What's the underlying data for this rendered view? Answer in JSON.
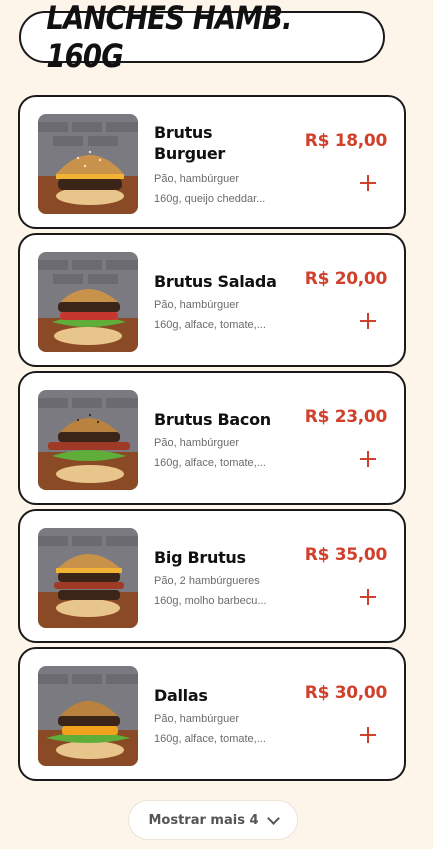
{
  "section_title": "LANCHES HAMB. 160G",
  "items": [
    {
      "name": "Brutus Burguer",
      "name_line1": "Brutus",
      "name_line2": "Burguer",
      "desc_line1": "Pão, hambúrguer",
      "desc_line2": "160g, queijo cheddar...",
      "price": "R$ 18,00",
      "image": "burger-cheese-photo"
    },
    {
      "name": "Brutus Salada",
      "desc_line1": "Pão, hambúrguer",
      "desc_line2": "160g, alface, tomate,...",
      "price": "R$ 20,00",
      "image": "burger-salad-photo"
    },
    {
      "name": "Brutus Bacon",
      "desc_line1": "Pão, hambúrguer",
      "desc_line2": "160g, alface, tomate,...",
      "price": "R$ 23,00",
      "image": "burger-bacon-photo"
    },
    {
      "name": "Big Brutus",
      "desc_line1": "Pão, 2 hambúrgueres",
      "desc_line2": "160g, molho barbecu...",
      "price": "R$ 35,00",
      "image": "burger-double-photo"
    },
    {
      "name": "Dallas",
      "desc_line1": "Pão, hambúrguer",
      "desc_line2": "160g, alface, tomate,...",
      "price": "R$ 30,00",
      "image": "burger-dallas-photo"
    }
  ],
  "show_more_label": "Mostrar mais 4",
  "colors": {
    "price": "#d0402b",
    "background": "#fdf4ea",
    "border": "#1a1a1a"
  },
  "icons": {
    "add": "plus-icon",
    "expand": "chevron-down-icon"
  }
}
